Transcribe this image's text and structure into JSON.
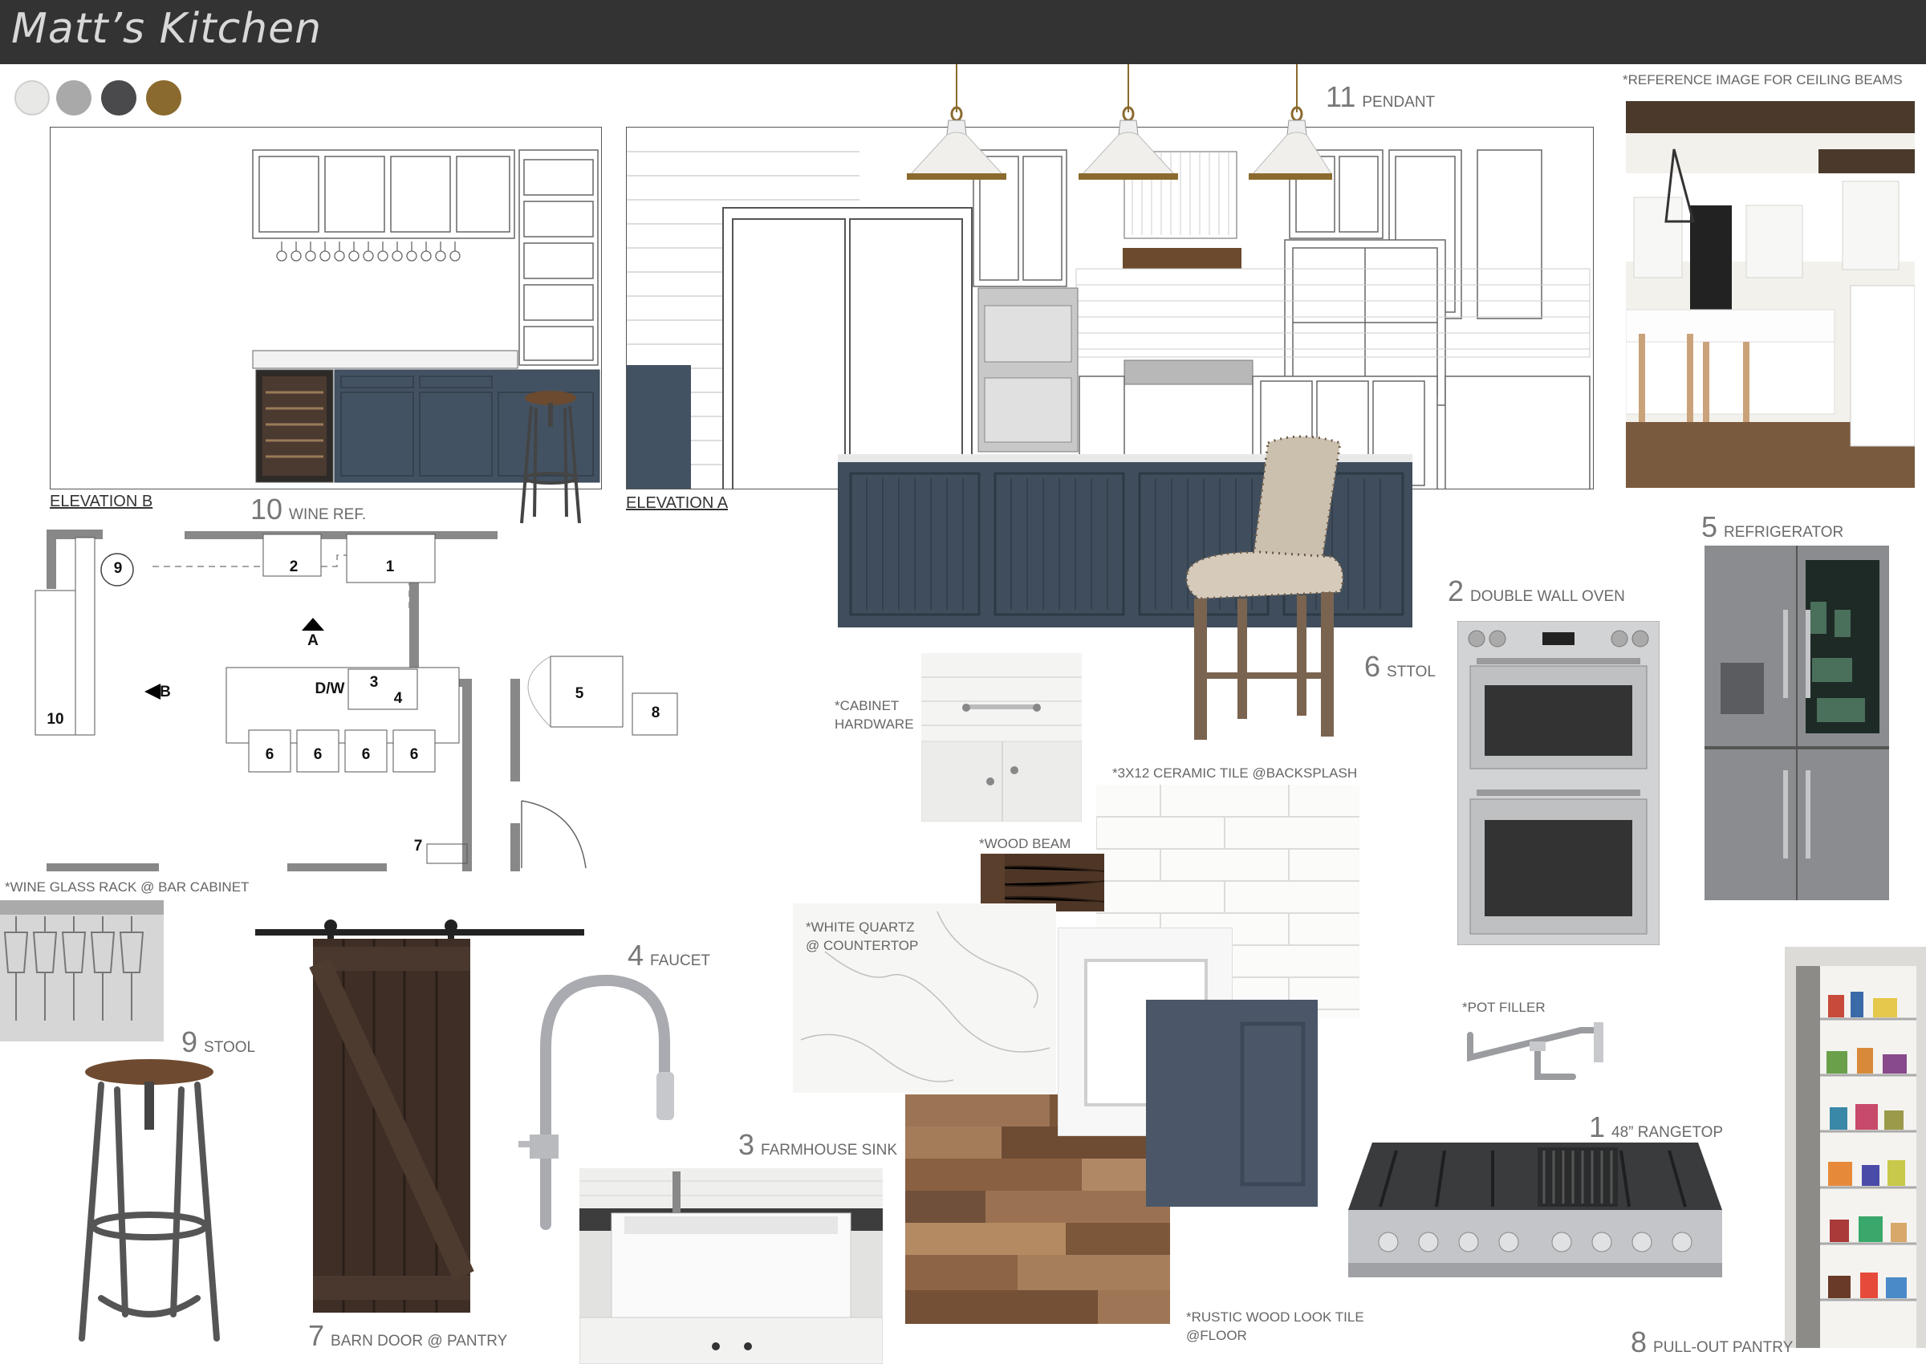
{
  "title": "Matt’s Kitchen",
  "palette": [
    {
      "name": "white",
      "color": "#e8e8e6"
    },
    {
      "name": "light-gray",
      "color": "#a9a9a9"
    },
    {
      "name": "charcoal",
      "color": "#4a4a4c"
    },
    {
      "name": "bronze",
      "color": "#8a6a2e"
    }
  ],
  "elevations": {
    "b_label": "ELEVATION B",
    "a_label": "ELEVATION A"
  },
  "plan": {
    "labels": {
      "n9": "9",
      "n2": "2",
      "n1": "1",
      "n10": "10",
      "n3": "3",
      "n4": "4",
      "dw": "D/W",
      "n5": "5",
      "n8": "8",
      "n6a": "6",
      "n6b": "6",
      "n6c": "6",
      "n6d": "6",
      "n7": "7",
      "arrow_a": "A",
      "arrow_b": "B"
    }
  },
  "items": {
    "pendant": {
      "num": "11",
      "text": "PENDANT"
    },
    "wine_ref": {
      "num": "10",
      "text": "WINE REF."
    },
    "refrigerator": {
      "num": "5",
      "text": "REFRIGERATOR"
    },
    "double_wall_oven": {
      "num": "2",
      "text": "DOUBLE WALL OVEN"
    },
    "sttol": {
      "num": "6",
      "text": "STTOL"
    },
    "faucet": {
      "num": "4",
      "text": "FAUCET"
    },
    "stool": {
      "num": "9",
      "text": "STOOL"
    },
    "farmhouse_sink": {
      "num": "3",
      "text": "FARMHOUSE SINK"
    },
    "barn_door": {
      "num": "7",
      "text": "BARN DOOR @ PANTRY"
    },
    "rangetop": {
      "num": "1",
      "text": "48” RANGETOP"
    },
    "pullout_pantry": {
      "num": "8",
      "text": "PULL-OUT PANTRY"
    }
  },
  "notes": {
    "ceiling_beams": "*REFERENCE IMAGE FOR CEILING BEAMS",
    "cabinet_hardware_1": "*CABINET",
    "cabinet_hardware_2": "HARDWARE",
    "backsplash": "*3X12 CERAMIC TILE @BACKSPLASH",
    "wood_beam": "*WOOD BEAM",
    "wine_glass_rack": "*WINE GLASS RACK @ BAR CABINET",
    "quartz_1": "*WHITE QUARTZ",
    "quartz_2": "@ COUNTERTOP",
    "pot_filler": "*POT FILLER",
    "floor_tile_1": "*RUSTIC WOOD LOOK TILE",
    "floor_tile_2": "@FLOOR"
  }
}
